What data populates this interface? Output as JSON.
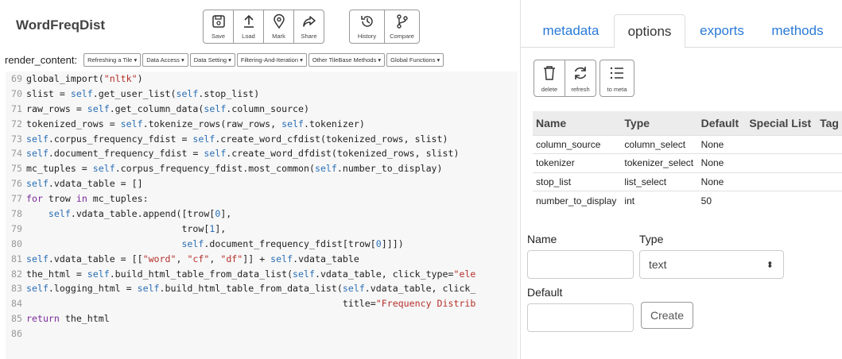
{
  "app": {
    "title": "WordFreqDist"
  },
  "toolbar": {
    "group1": [
      {
        "label": "Save",
        "icon": "save-icon"
      },
      {
        "label": "Load",
        "icon": "upload-icon"
      },
      {
        "label": "Mark",
        "icon": "map-marker-icon"
      },
      {
        "label": "Share",
        "icon": "share-icon"
      }
    ],
    "group2": [
      {
        "label": "History",
        "icon": "history-icon"
      },
      {
        "label": "Compare",
        "icon": "branch-icon"
      }
    ]
  },
  "render": {
    "label": "render_content:",
    "menus": [
      "Refreshing a Tile ▾",
      "Data Access ▾",
      "Data Setting ▾",
      "Filtering-And-Iteration ▾",
      "Other TileBase Methods ▾",
      "Global Functions ▾"
    ]
  },
  "code": {
    "lines": [
      {
        "n": "69",
        "t": "global_import(\"nltk\")"
      },
      {
        "n": "70",
        "t": "slist = self.get_user_list(self.stop_list)"
      },
      {
        "n": "71",
        "t": "raw_rows = self.get_column_data(self.column_source)"
      },
      {
        "n": "72",
        "t": "tokenized_rows = self.tokenize_rows(raw_rows, self.tokenizer)"
      },
      {
        "n": "73",
        "t": "self.corpus_frequency_fdist = self.create_word_cfdist(tokenized_rows, slist)"
      },
      {
        "n": "74",
        "t": "self.document_frequency_fdist = self.create_word_dfdist(tokenized_rows, slist)"
      },
      {
        "n": "75",
        "t": "mc_tuples = self.corpus_frequency_fdist.most_common(self.number_to_display)"
      },
      {
        "n": "76",
        "t": "self.vdata_table = []"
      },
      {
        "n": "77",
        "t": "for trow in mc_tuples:"
      },
      {
        "n": "78",
        "t": "    self.vdata_table.append([trow[0],"
      },
      {
        "n": "79",
        "t": "                            trow[1],"
      },
      {
        "n": "80",
        "t": "                            self.document_frequency_fdist[trow[0]]])"
      },
      {
        "n": "81",
        "t": "self.vdata_table = [[\"word\", \"cf\", \"df\"]] + self.vdata_table"
      },
      {
        "n": "82",
        "t": "the_html = self.build_html_table_from_data_list(self.vdata_table, click_type=\"ele"
      },
      {
        "n": "83",
        "t": "self.logging_html = self.build_html_table_from_data_list(self.vdata_table, click_"
      },
      {
        "n": "84",
        "t": "                                                         title=\"Frequency Distrib"
      },
      {
        "n": "85",
        "t": "return the_html"
      },
      {
        "n": "86",
        "t": ""
      }
    ]
  },
  "tabs": [
    {
      "label": "metadata",
      "active": false
    },
    {
      "label": "options",
      "active": true
    },
    {
      "label": "exports",
      "active": false
    },
    {
      "label": "methods",
      "active": false
    }
  ],
  "options_toolbar": [
    {
      "label": "delete",
      "icon": "trash-icon"
    },
    {
      "label": "refresh",
      "icon": "refresh-icon"
    },
    {
      "label": "to meta",
      "icon": "list-icon"
    }
  ],
  "options_table": {
    "headers": [
      "Name",
      "Type",
      "Default",
      "Special List",
      "Tag"
    ],
    "rows": [
      [
        "column_source",
        "column_select",
        "None",
        "",
        ""
      ],
      [
        "tokenizer",
        "tokenizer_select",
        "None",
        "",
        ""
      ],
      [
        "stop_list",
        "list_select",
        "None",
        "",
        ""
      ],
      [
        "number_to_display",
        "int",
        "50",
        "",
        ""
      ]
    ]
  },
  "form": {
    "name_label": "Name",
    "type_label": "Type",
    "type_value": "text",
    "default_label": "Default",
    "create_label": "Create"
  },
  "colors": {
    "tab_link": "#2a7ad8",
    "code_bg": "#f7f7f7",
    "keyword": "#7a2a9a",
    "self": "#2a6fb5",
    "string": "#b5302a"
  }
}
